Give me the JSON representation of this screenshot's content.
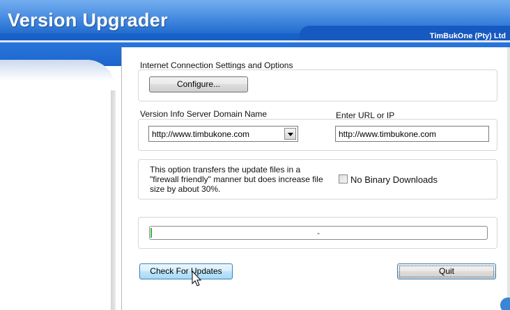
{
  "window": {
    "title": "Version Upgrader",
    "company": "TimBukOne (Pty) Ltd"
  },
  "connection": {
    "label": "Internet Connection Settings and Options",
    "configure_button": "Configure..."
  },
  "server": {
    "label": "Version Info Server Domain Name",
    "selected": "http://www.timbukone.com",
    "url_label": "Enter URL or IP",
    "url_value": "http://www.timbukone.com"
  },
  "binary": {
    "description": "This option transfers the update files in a \"firewall friendly\" manner but does increase file size by about 30%.",
    "checkbox_label": "No Binary Downloads",
    "checked": false
  },
  "progress": {
    "text": "-",
    "percent": 0
  },
  "actions": {
    "check_button": "Check For Updates",
    "quit_button": "Quit"
  },
  "colors": {
    "banner": "#1e6fd6",
    "progress_fill": "#3cb043"
  }
}
